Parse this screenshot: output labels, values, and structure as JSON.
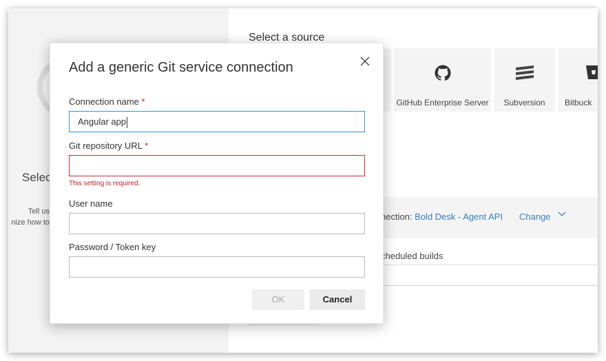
{
  "background": {
    "left_title": "Selec",
    "left_desc_line1": "Tell us",
    "left_desc_line2": "nize how to",
    "select_source_heading": "Select a source",
    "source_tiles": [
      {
        "label": "GitHub Enterprise Server",
        "icon": "github-icon"
      },
      {
        "label": "Subversion",
        "icon": "subversion-icon"
      },
      {
        "label": "Bitbuck",
        "icon": "bitbucket-icon"
      }
    ],
    "connection_prefix": "nection: ",
    "connection_name": "Bold Desk - Agent API",
    "change_label": "Change",
    "scheduled_label": "cheduled builds"
  },
  "dialog": {
    "title": "Add a generic Git service connection",
    "close_icon": "close-icon",
    "fields": {
      "connection_name": {
        "label": "Connection name",
        "required": true,
        "value": "Angular app"
      },
      "git_url": {
        "label": "Git repository URL",
        "required": true,
        "value": "",
        "error": "This setting is required."
      },
      "user_name": {
        "label": "User name",
        "value": ""
      },
      "password": {
        "label": "Password / Token key",
        "value": ""
      }
    },
    "required_marker": "*",
    "ok_label": "OK",
    "cancel_label": "Cancel"
  },
  "colors": {
    "accent": "#3f8fc9",
    "error": "#c0303a",
    "link": "#3a7fc2"
  }
}
